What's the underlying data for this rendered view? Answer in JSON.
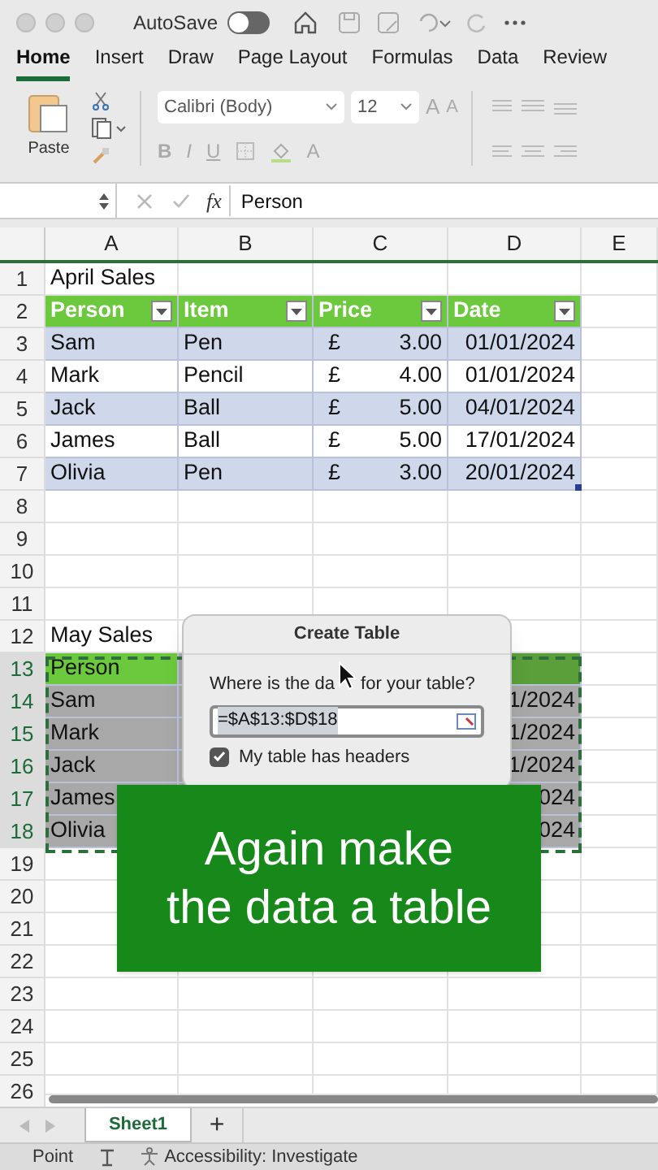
{
  "title_bar": {
    "autosave_label": "AutoSave",
    "autosave_on": false
  },
  "ribbon_tabs": [
    {
      "label": "Home",
      "selected": true
    },
    {
      "label": "Insert",
      "selected": false
    },
    {
      "label": "Draw",
      "selected": false
    },
    {
      "label": "Page Layout",
      "selected": false
    },
    {
      "label": "Formulas",
      "selected": false
    },
    {
      "label": "Data",
      "selected": false
    },
    {
      "label": "Review",
      "selected": false
    }
  ],
  "ribbon": {
    "paste_label": "Paste",
    "font": "Calibri (Body)",
    "font_size": "12",
    "grow_font": "A",
    "shrink_font": "A",
    "bold": "B",
    "italic": "I",
    "underline": "U",
    "font_color": "A"
  },
  "formula_bar": {
    "fx": "fx",
    "content": "Person"
  },
  "sheet": {
    "columns": [
      "A",
      "B",
      "C",
      "D",
      "E"
    ],
    "rows": [
      {
        "number": "1",
        "kind": "plain",
        "a": "April Sales"
      },
      {
        "number": "2",
        "kind": "table_header",
        "a": "Person",
        "b": "Item",
        "c": "Price",
        "d": "Date"
      },
      {
        "number": "3",
        "kind": "band",
        "a": "Sam",
        "b": "Pen",
        "c": {
          "currency": "£",
          "amount": "3.00"
        },
        "d": "01/01/2024"
      },
      {
        "number": "4",
        "kind": "table_row",
        "a": "Mark",
        "b": "Pencil",
        "c": {
          "currency": "£",
          "amount": "4.00"
        },
        "d": "01/01/2024"
      },
      {
        "number": "5",
        "kind": "band",
        "a": "Jack",
        "b": "Ball",
        "c": {
          "currency": "£",
          "amount": "5.00"
        },
        "d": "04/01/2024"
      },
      {
        "number": "6",
        "kind": "table_row",
        "a": "James",
        "b": "Ball",
        "c": {
          "currency": "£",
          "amount": "5.00"
        },
        "d": "17/01/2024"
      },
      {
        "number": "7",
        "kind": "band",
        "a": "Olivia",
        "b": "Pen",
        "c": {
          "currency": "£",
          "amount": "3.00"
        },
        "d": "20/01/2024"
      },
      {
        "number": "8",
        "kind": "plain"
      },
      {
        "number": "9",
        "kind": "plain"
      },
      {
        "number": "10",
        "kind": "plain"
      },
      {
        "number": "11",
        "kind": "plain"
      },
      {
        "number": "12",
        "kind": "plain",
        "a": "May Sales"
      },
      {
        "number": "13",
        "kind": "selected_header",
        "a": "Person"
      },
      {
        "number": "14",
        "kind": "selected_row",
        "a": "Sam",
        "d": "1/2024"
      },
      {
        "number": "15",
        "kind": "selected_row",
        "a": "Mark",
        "d": "1/2024"
      },
      {
        "number": "16",
        "kind": "selected_row",
        "a": "Jack",
        "d": "1/2024"
      },
      {
        "number": "17",
        "kind": "selected_row",
        "a": "James",
        "d": "024"
      },
      {
        "number": "18",
        "kind": "selected_row",
        "a": "Olivia",
        "d": "024"
      },
      {
        "number": "19",
        "kind": "plain"
      },
      {
        "number": "20",
        "kind": "plain"
      },
      {
        "number": "21",
        "kind": "plain"
      },
      {
        "number": "22",
        "kind": "plain"
      },
      {
        "number": "23",
        "kind": "plain"
      },
      {
        "number": "24",
        "kind": "plain"
      },
      {
        "number": "25",
        "kind": "plain"
      },
      {
        "number": "26",
        "kind": "plain"
      }
    ]
  },
  "dialog": {
    "title": "Create Table",
    "prompt_parts": [
      "Where is the da",
      "for your table?"
    ],
    "range": "=$A$13:$D$18",
    "headers_checked": true,
    "headers_label": "My table has headers"
  },
  "caption": {
    "lines": [
      "Again make",
      "the data a table"
    ]
  },
  "sheet_tabs": [
    {
      "label": "Sheet1",
      "selected": true
    }
  ],
  "add_sheet": "+",
  "status_bar": {
    "mode": "Point",
    "accessibility": "Accessibility: Investigate"
  }
}
